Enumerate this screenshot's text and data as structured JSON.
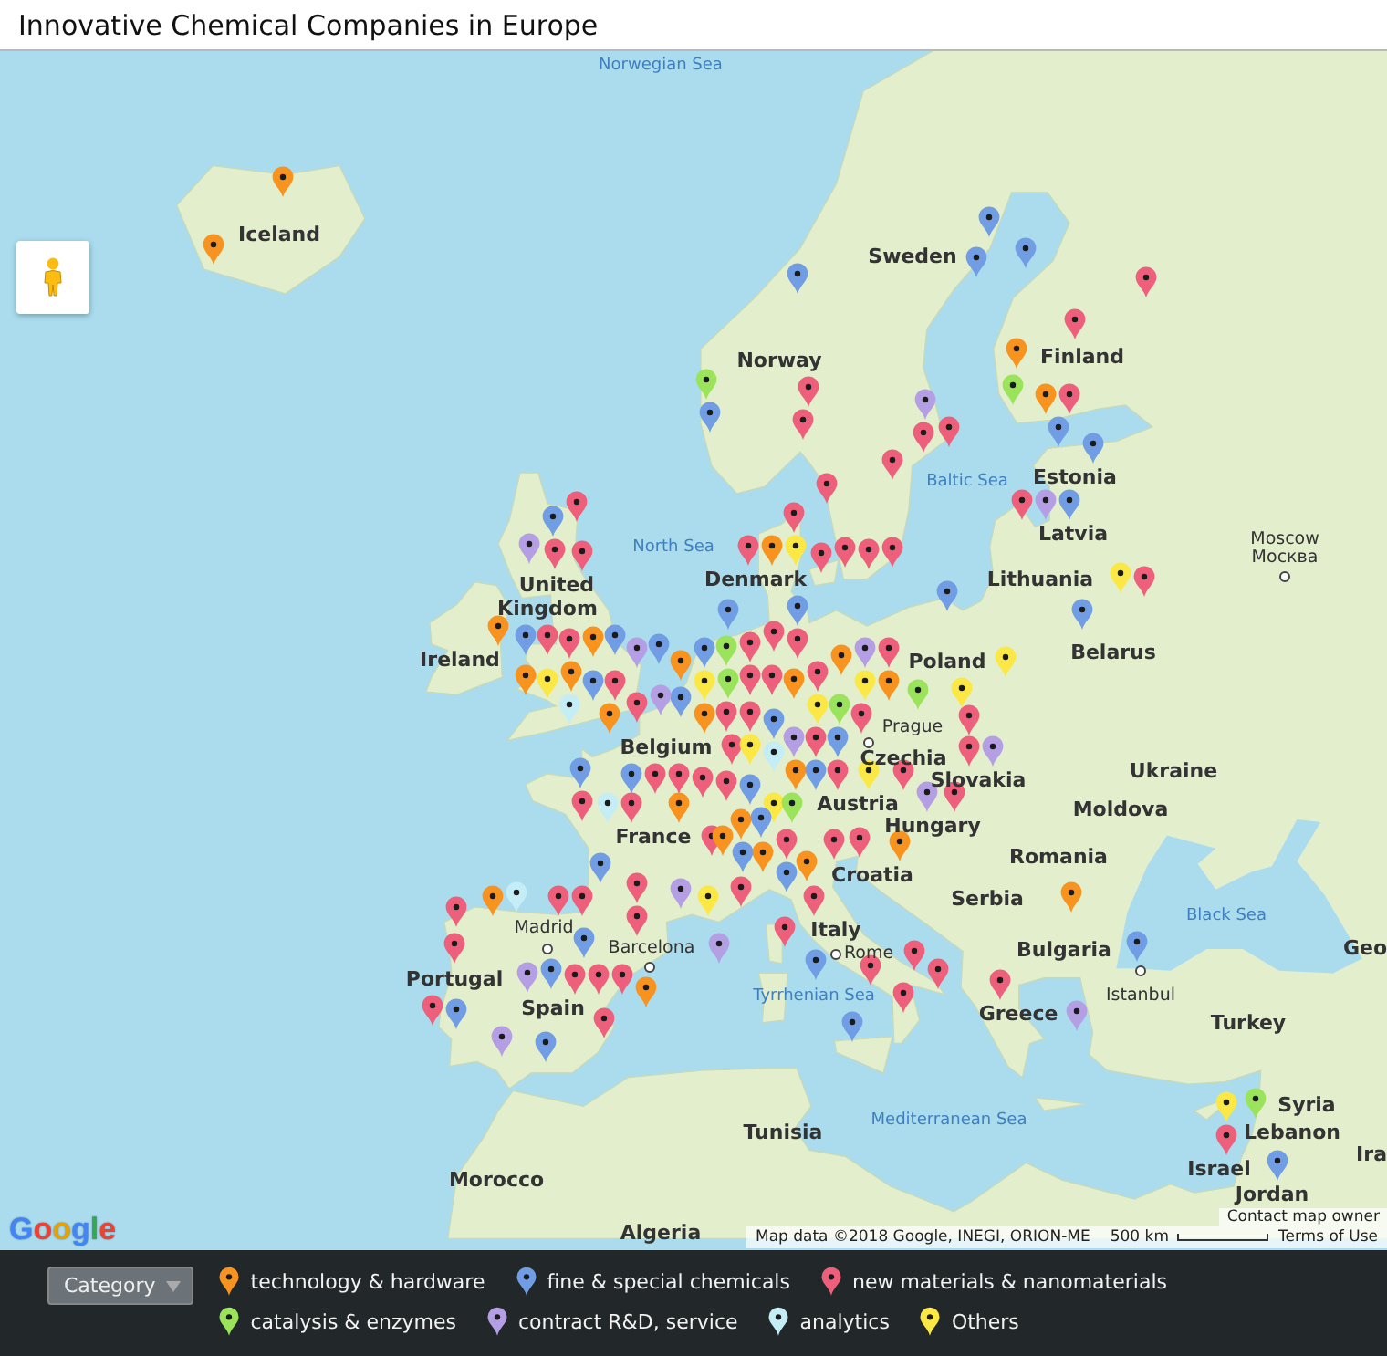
{
  "title": "Innovative Chemical Companies in Europe",
  "map_labels": [
    {
      "text": "Norwegian Sea",
      "kind": "sea"
    },
    {
      "text": "Iceland",
      "kind": "country"
    },
    {
      "text": "Sweden",
      "kind": "country"
    },
    {
      "text": "Norway",
      "kind": "country"
    },
    {
      "text": "Finland",
      "kind": "country"
    },
    {
      "text": "Baltic Sea",
      "kind": "sea"
    },
    {
      "text": "Estonia",
      "kind": "country"
    },
    {
      "text": "North Sea",
      "kind": "sea"
    },
    {
      "text": "Latvia",
      "kind": "country"
    },
    {
      "text": "Moscow",
      "kind": "city"
    },
    {
      "text": "Москва",
      "kind": "city"
    },
    {
      "text": "United",
      "kind": "country"
    },
    {
      "text": "Denmark",
      "kind": "country"
    },
    {
      "text": "Lithuania",
      "kind": "country"
    },
    {
      "text": "Kingdom",
      "kind": "country"
    },
    {
      "text": "Ireland",
      "kind": "country"
    },
    {
      "text": "Poland",
      "kind": "country"
    },
    {
      "text": "Belarus",
      "kind": "country"
    },
    {
      "text": "Prague",
      "kind": "city"
    },
    {
      "text": "Belgium",
      "kind": "country"
    },
    {
      "text": "Czechia",
      "kind": "country"
    },
    {
      "text": "Slovakia",
      "kind": "country"
    },
    {
      "text": "Ukraine",
      "kind": "country"
    },
    {
      "text": "Austria",
      "kind": "country"
    },
    {
      "text": "Moldova",
      "kind": "country"
    },
    {
      "text": "France",
      "kind": "country"
    },
    {
      "text": "Hungary",
      "kind": "country"
    },
    {
      "text": "Romania",
      "kind": "country"
    },
    {
      "text": "Croatia",
      "kind": "country"
    },
    {
      "text": "Serbia",
      "kind": "country"
    },
    {
      "text": "Madrid",
      "kind": "city"
    },
    {
      "text": "Italy",
      "kind": "country"
    },
    {
      "text": "Black Sea",
      "kind": "sea"
    },
    {
      "text": "Barcelona",
      "kind": "city"
    },
    {
      "text": "Rome",
      "kind": "city"
    },
    {
      "text": "Bulgaria",
      "kind": "country"
    },
    {
      "text": "Geo",
      "kind": "country"
    },
    {
      "text": "Portugal",
      "kind": "country"
    },
    {
      "text": "Spain",
      "kind": "country"
    },
    {
      "text": "Tyrrhenian Sea",
      "kind": "sea"
    },
    {
      "text": "Greece",
      "kind": "country"
    },
    {
      "text": "Istanbul",
      "kind": "city"
    },
    {
      "text": "Turkey",
      "kind": "country"
    },
    {
      "text": "Tunisia",
      "kind": "country"
    },
    {
      "text": "Mediterranean Sea",
      "kind": "sea"
    },
    {
      "text": "Syria",
      "kind": "country"
    },
    {
      "text": "Lebanon",
      "kind": "country"
    },
    {
      "text": "Morocco",
      "kind": "country"
    },
    {
      "text": "Israel",
      "kind": "country"
    },
    {
      "text": "Ira",
      "kind": "country"
    },
    {
      "text": "Jordan",
      "kind": "country"
    },
    {
      "text": "Algeria",
      "kind": "country"
    }
  ],
  "markers": [
    {
      "color": "#f7931e"
    },
    {
      "color": "#f7931e"
    },
    {
      "color": "#ee5f7b"
    },
    {
      "color": "#9be35a"
    },
    {
      "color": "#709de3"
    },
    {
      "color": "#709de3"
    },
    {
      "color": "#ee5f7b"
    },
    {
      "color": "#ee5f7b"
    },
    {
      "color": "#ee5f7b"
    },
    {
      "color": "#b49ee4"
    },
    {
      "color": "#ee5f7b"
    },
    {
      "color": "#ee5f7b"
    },
    {
      "color": "#ee5f7b"
    },
    {
      "color": "#709de3"
    },
    {
      "color": "#709de3"
    },
    {
      "color": "#ee5f7b"
    },
    {
      "color": "#ee5f7b"
    },
    {
      "color": "#f7931e"
    },
    {
      "color": "#f7931e"
    },
    {
      "color": "#ee5f7b"
    },
    {
      "color": "#709de3"
    },
    {
      "color": "#ee5f7b"
    },
    {
      "color": "#9be35a"
    },
    {
      "color": "#709de3"
    },
    {
      "color": "#709de3"
    },
    {
      "color": "#ee5f7b"
    },
    {
      "color": "#709de3"
    },
    {
      "color": "#b49ee4"
    },
    {
      "color": "#fbe844"
    },
    {
      "color": "#ee5f7b"
    },
    {
      "color": "#709de3"
    },
    {
      "color": "#fbe844"
    },
    {
      "color": "#ee5f7b"
    },
    {
      "color": "#9be35a"
    },
    {
      "color": "#fbe844"
    },
    {
      "color": "#709de3"
    },
    {
      "color": "#ee5f7b"
    },
    {
      "color": "#ee5f7b"
    },
    {
      "color": "#ee5f7b"
    },
    {
      "color": "#fbe844"
    },
    {
      "color": "#f7931e"
    },
    {
      "color": "#ee5f7b"
    },
    {
      "color": "#ee5f7b"
    },
    {
      "color": "#709de3"
    },
    {
      "color": "#ee5f7b"
    },
    {
      "color": "#709de3"
    },
    {
      "color": "#f7931e"
    },
    {
      "color": "#b49ee4"
    },
    {
      "color": "#ee5f7b"
    },
    {
      "color": "#ee5f7b"
    },
    {
      "color": "#b49ee4"
    },
    {
      "color": "#ee5f7b"
    },
    {
      "color": "#709de3"
    },
    {
      "color": "#ee5f7b"
    },
    {
      "color": "#f7931e"
    },
    {
      "color": "#fbe844"
    },
    {
      "color": "#c4edf6"
    },
    {
      "color": "#709de3"
    },
    {
      "color": "#f7931e"
    },
    {
      "color": "#709de3"
    },
    {
      "color": "#f7931e"
    },
    {
      "color": "#ee5f7b"
    },
    {
      "color": "#f7931e"
    },
    {
      "color": "#709de3"
    },
    {
      "color": "#ee5f7b"
    },
    {
      "color": "#709de3"
    },
    {
      "color": "#b49ee4"
    },
    {
      "color": "#f7931e"
    },
    {
      "color": "#9be35a"
    },
    {
      "color": "#709de3"
    },
    {
      "color": "#fbe844"
    },
    {
      "color": "#ee5f7b"
    },
    {
      "color": "#b49ee4"
    },
    {
      "color": "#ee5f7b"
    },
    {
      "color": "#f7931e"
    },
    {
      "color": "#9be35a"
    },
    {
      "color": "#ee5f7b"
    },
    {
      "color": "#709de3"
    },
    {
      "color": "#ee5f7b"
    },
    {
      "color": "#b49ee4"
    },
    {
      "color": "#f7931e"
    },
    {
      "color": "#ee5f7b"
    },
    {
      "color": "#709de3"
    },
    {
      "color": "#fbe844"
    },
    {
      "color": "#f7931e"
    },
    {
      "color": "#9be35a"
    },
    {
      "color": "#f7931e"
    },
    {
      "color": "#ee5f7b"
    },
    {
      "color": "#709de3"
    },
    {
      "color": "#ee5f7b"
    },
    {
      "color": "#c4edf6"
    },
    {
      "color": "#ee5f7b"
    },
    {
      "color": "#fbe844"
    },
    {
      "color": "#ee5f7b"
    },
    {
      "color": "#709de3"
    },
    {
      "color": "#ee5f7b"
    },
    {
      "color": "#ee5f7b"
    },
    {
      "color": "#fbe844"
    },
    {
      "color": "#ee5f7b"
    },
    {
      "color": "#f7931e"
    },
    {
      "color": "#709de3"
    },
    {
      "color": "#ee5f7b"
    },
    {
      "color": "#fbe844"
    },
    {
      "color": "#b49ee4"
    },
    {
      "color": "#9be35a"
    },
    {
      "color": "#ee5f7b"
    },
    {
      "color": "#ee5f7b"
    },
    {
      "color": "#b49ee4"
    },
    {
      "color": "#ee5f7b"
    },
    {
      "color": "#709de3"
    },
    {
      "color": "#ee5f7b"
    },
    {
      "color": "#709de3"
    },
    {
      "color": "#fbe844"
    },
    {
      "color": "#ee5f7b"
    },
    {
      "color": "#709de3"
    },
    {
      "color": "#ee5f7b"
    },
    {
      "color": "#709de3"
    },
    {
      "color": "#ee5f7b"
    },
    {
      "color": "#709de3"
    },
    {
      "color": "#f7931e"
    },
    {
      "color": "#ee5f7b"
    },
    {
      "color": "#b49ee4"
    },
    {
      "color": "#f7931e"
    },
    {
      "color": "#c4edf6"
    },
    {
      "color": "#f7931e"
    },
    {
      "color": "#ee5f7b"
    },
    {
      "color": "#fbe844"
    },
    {
      "color": "#ee5f7b"
    },
    {
      "color": "#ee5f7b"
    },
    {
      "color": "#709de3"
    },
    {
      "color": "#b49ee4"
    },
    {
      "color": "#ee5f7b"
    },
    {
      "color": "#f7931e"
    },
    {
      "color": "#ee5f7b"
    },
    {
      "color": "#b49ee4"
    },
    {
      "color": "#709de3"
    },
    {
      "color": "#ee5f7b"
    },
    {
      "color": "#f7931e"
    },
    {
      "color": "#ee5f7b"
    },
    {
      "color": "#ee5f7b"
    },
    {
      "color": "#b49ee4"
    },
    {
      "color": "#709de3"
    },
    {
      "color": "#ee5f7b"
    },
    {
      "color": "#709de3"
    },
    {
      "color": "#ee5f7b"
    },
    {
      "color": "#ee5f7b"
    },
    {
      "color": "#ee5f7b"
    },
    {
      "color": "#c4edf6"
    },
    {
      "color": "#ee5f7b"
    },
    {
      "color": "#f7931e"
    },
    {
      "color": "#ee5f7b"
    },
    {
      "color": "#f7931e"
    },
    {
      "color": "#ee5f7b"
    },
    {
      "color": "#ee5f7b"
    },
    {
      "color": "#709de3"
    },
    {
      "color": "#ee5f7b"
    },
    {
      "color": "#ee5f7b"
    },
    {
      "color": "#709de3"
    },
    {
      "color": "#709de3"
    },
    {
      "color": "#ee5f7b"
    },
    {
      "color": "#ee5f7b"
    },
    {
      "color": "#ee5f7b"
    },
    {
      "color": "#f7931e"
    },
    {
      "color": "#ee5f7b"
    },
    {
      "color": "#ee5f7b"
    },
    {
      "color": "#b49ee4"
    },
    {
      "color": "#f7931e"
    },
    {
      "color": "#709de3"
    },
    {
      "color": "#9be35a"
    },
    {
      "color": "#fbe844"
    },
    {
      "color": "#ee5f7b"
    },
    {
      "color": "#709de3"
    }
  ],
  "logo": "Google",
  "attribution": {
    "contact": "Contact map owner",
    "data": "Map data ©2018 Google, INEGI, ORION-ME",
    "scale": "500 km",
    "terms": "Terms of Use"
  },
  "legend": {
    "button": "Category",
    "items": [
      {
        "label": "technology & hardware",
        "color": "#f7931e"
      },
      {
        "label": "fine & special chemicals",
        "color": "#709de3"
      },
      {
        "label": "new materials & nanomaterials",
        "color": "#ee5f7b"
      },
      {
        "label": "catalysis & enzymes",
        "color": "#9be35a"
      },
      {
        "label": "contract R&D, service",
        "color": "#b49ee4"
      },
      {
        "label": "analytics",
        "color": "#c4edf6"
      },
      {
        "label": "Others",
        "color": "#fbe844"
      }
    ]
  }
}
